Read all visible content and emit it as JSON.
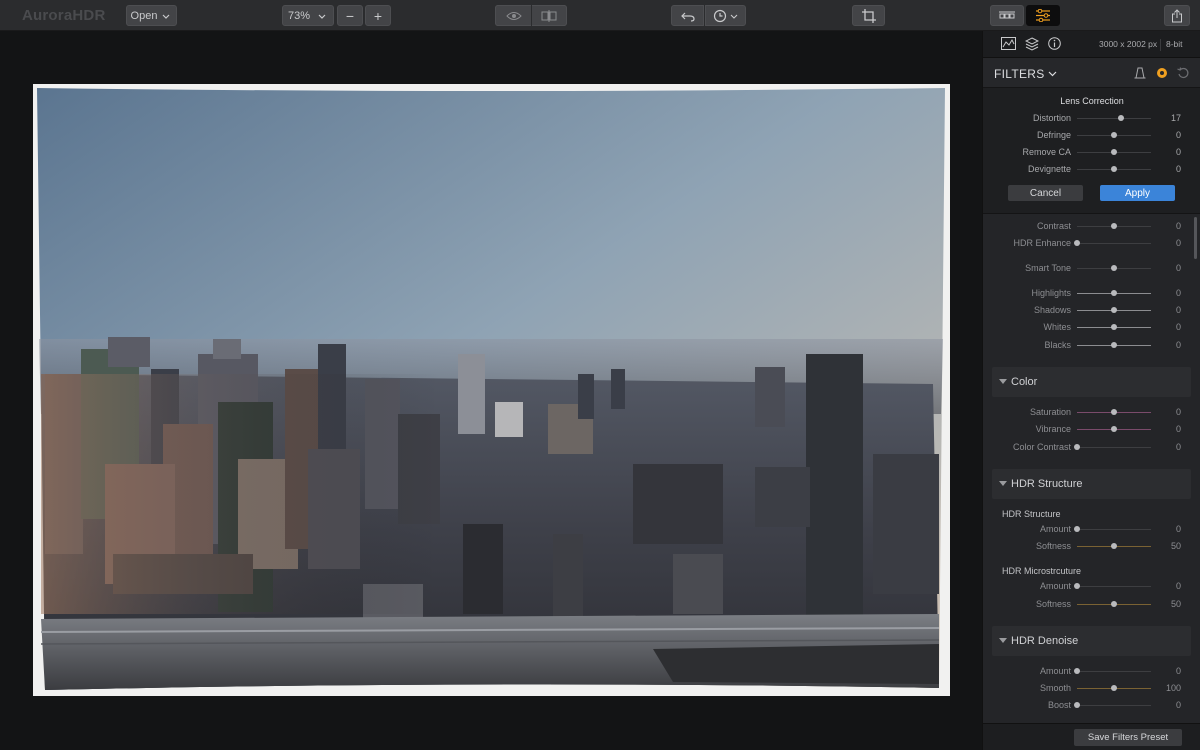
{
  "app": {
    "name": "AuroraHDR"
  },
  "toolbar": {
    "open_label": "Open",
    "zoom_value": "73%",
    "zoom_out_symbol": "−",
    "zoom_in_symbol": "+",
    "icons": [
      "eye-icon",
      "compare-icon",
      "undo-icon",
      "history-icon",
      "crop-icon",
      "presets-panel-icon",
      "adjustments-panel-icon",
      "share-icon"
    ]
  },
  "panel": {
    "image_dimensions": "3000 x 2002 px",
    "bit_depth": "8-bit",
    "filters_title": "FILTERS",
    "icons": [
      "histogram-icon",
      "layers-icon",
      "info-icon",
      "mask-icon",
      "filter-color-icon",
      "reset-icon"
    ],
    "lens_correction": {
      "title": "Lens Correction",
      "sliders": [
        {
          "label": "Distortion",
          "value": "17",
          "level": 0.6
        },
        {
          "label": "Defringe",
          "value": "0",
          "level": 0.5
        },
        {
          "label": "Remove CA",
          "value": "0",
          "level": 0.5
        },
        {
          "label": "Devignette",
          "value": "0",
          "level": 0.5
        }
      ],
      "cancel_label": "Cancel",
      "apply_label": "Apply"
    },
    "top_sliders": [
      {
        "label": "Contrast",
        "value": "0",
        "level": 0.5
      },
      {
        "label": "HDR Enhance",
        "value": "0",
        "level": 0.0
      },
      {
        "label": "Smart Tone",
        "value": "0",
        "level": 0.5
      },
      {
        "label": "Highlights",
        "value": "0",
        "level": 0.5
      },
      {
        "label": "Shadows",
        "value": "0",
        "level": 0.5
      },
      {
        "label": "Whites",
        "value": "0",
        "level": 0.5
      },
      {
        "label": "Blacks",
        "value": "0",
        "level": 0.5
      }
    ],
    "color": {
      "title": "Color",
      "sliders": [
        {
          "label": "Saturation",
          "value": "0",
          "level": 0.5
        },
        {
          "label": "Vibrance",
          "value": "0",
          "level": 0.5
        },
        {
          "label": "Color Contrast",
          "value": "0",
          "level": 0.0
        }
      ]
    },
    "hdr_structure": {
      "title": "HDR Structure",
      "group1_title": "HDR Structure",
      "group1": [
        {
          "label": "Amount",
          "value": "0",
          "level": 0.0
        },
        {
          "label": "Softness",
          "value": "50",
          "level": 0.5
        }
      ],
      "group2_title": "HDR Microstrcuture",
      "group2": [
        {
          "label": "Amount",
          "value": "0",
          "level": 0.0
        },
        {
          "label": "Softness",
          "value": "50",
          "level": 0.5
        }
      ]
    },
    "hdr_denoise": {
      "title": "HDR Denoise",
      "sliders": [
        {
          "label": "Amount",
          "value": "0",
          "level": 0.0
        },
        {
          "label": "Smooth",
          "value": "100",
          "level": 0.5
        },
        {
          "label": "Boost",
          "value": "0",
          "level": 0.0
        }
      ]
    },
    "save_preset_label": "Save Filters Preset"
  },
  "colors": {
    "accent_blue": "#3b84d9",
    "panel_bg": "#242528",
    "toolbar_bg": "#2b2c2e",
    "canvas_bg": "#131415",
    "orange_icon": "#f0a020"
  }
}
